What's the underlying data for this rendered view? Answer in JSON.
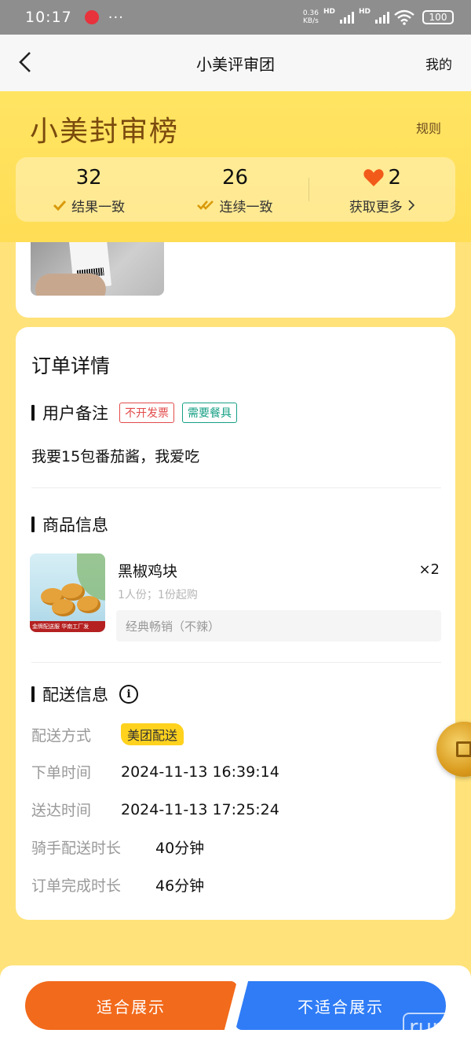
{
  "status_bar": {
    "time": "10:17",
    "more": "···",
    "net_speed": "0.36",
    "net_unit": "KB/s",
    "hd1": "HD",
    "hd2": "HD",
    "battery": "100"
  },
  "nav": {
    "title": "小美评审团",
    "right_link": "我的",
    "back_icon": "chevron-left-icon"
  },
  "hero": {
    "brand": "小美封审榜",
    "rules": "规则",
    "stats": [
      {
        "value": "32",
        "label": "结果一致"
      },
      {
        "value": "26",
        "label": "连续一致"
      },
      {
        "value": "2",
        "label": "获取更多"
      }
    ]
  },
  "order": {
    "title": "订单详情",
    "remark_section": {
      "heading": "用户备注",
      "tags": [
        "不开发票",
        "需要餐具"
      ],
      "remark": "我要15包番茄酱，我爱吃"
    },
    "product_section": {
      "heading": "商品信息",
      "name": "黑椒鸡块",
      "qty": "×2",
      "sub": "1人份；1份起购",
      "spec": "经典畅销（不辣）",
      "image_strip": "金牌配送服  华南工厂发"
    },
    "delivery_section": {
      "heading": "配送信息",
      "rows": [
        {
          "key": "配送方式",
          "value": "美团配送"
        },
        {
          "key": "下单时间",
          "value": "2024-11-13 16:39:14"
        },
        {
          "key": "送达时间",
          "value": "2024-11-13 17:25:24"
        },
        {
          "key": "骑手配送时长",
          "value": "40分钟"
        },
        {
          "key": "订单完成时长",
          "value": "46分钟"
        }
      ]
    }
  },
  "actions": {
    "approve": "适合展示",
    "reject": "不适合展示"
  },
  "watermark": "run",
  "colors": {
    "accent_yellow": "#FFDD55",
    "approve": "#F26A1B",
    "reject": "#2F7CF6",
    "heart": "#F25A1A"
  }
}
